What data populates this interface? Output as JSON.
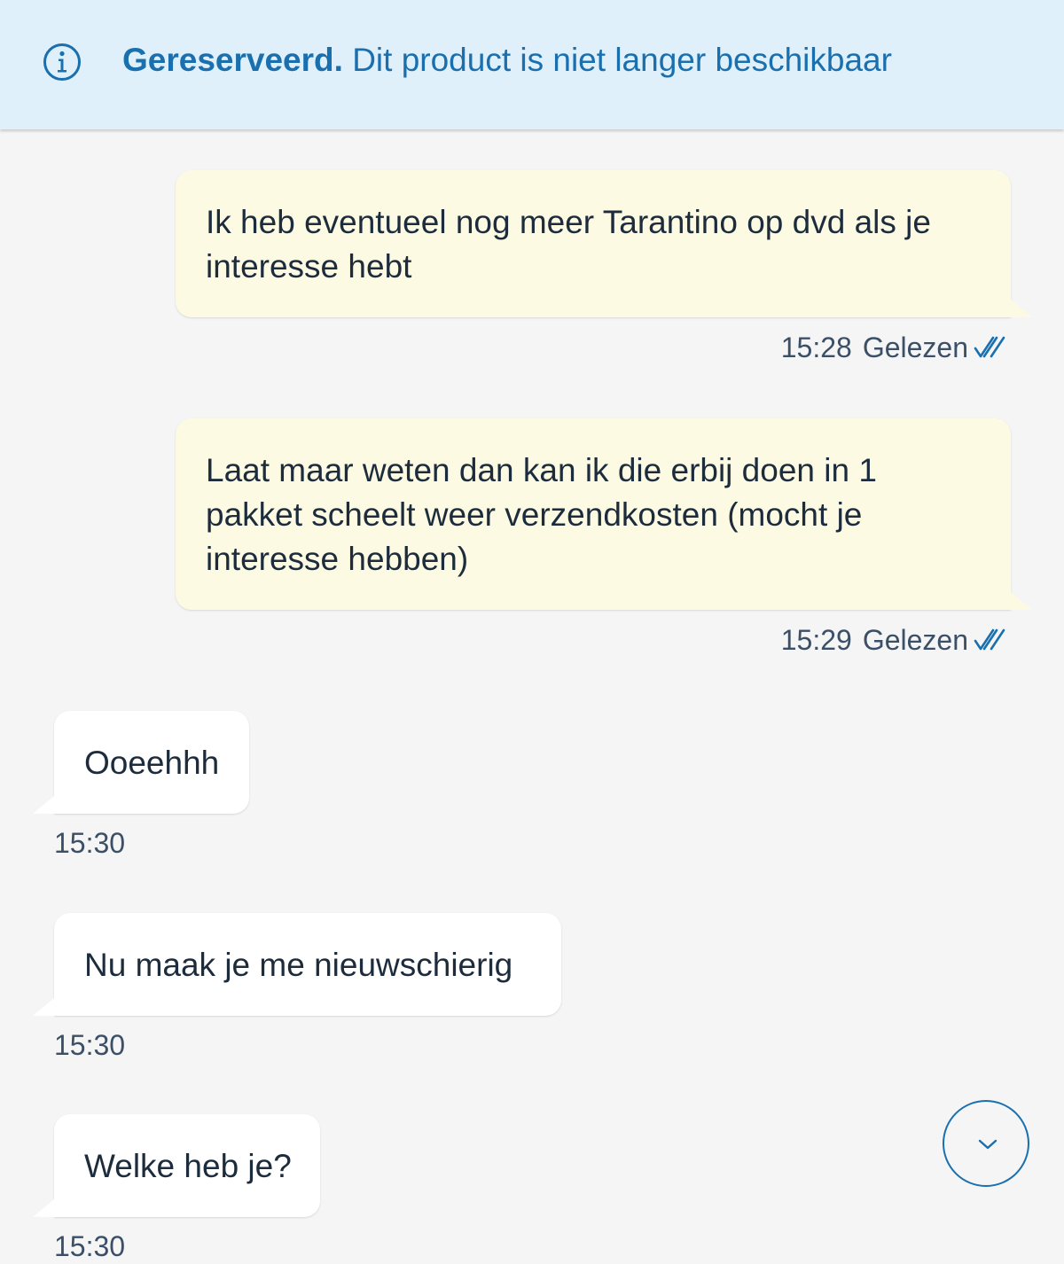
{
  "banner": {
    "icon": "info-icon",
    "status": "Gereserveerd.",
    "message": "Dit product is niet langer beschikbaar"
  },
  "colors": {
    "banner_bg": "#dff0fa",
    "accent": "#1a6fae",
    "outgoing_bubble": "#fdfae3",
    "incoming_bubble": "#ffffff",
    "background": "#f5f5f5"
  },
  "messages": [
    {
      "direction": "out",
      "text": "Ik heb eventueel nog meer Tarantino op dvd als je interesse hebt",
      "time": "15:28",
      "status": "Gelezen"
    },
    {
      "direction": "out",
      "text": "Laat maar weten dan kan ik die erbij doen in 1 pakket scheelt weer verzendkosten (mocht je interesse hebben)",
      "time": "15:29",
      "status": "Gelezen"
    },
    {
      "direction": "in",
      "text": "Ooeehhh",
      "time": "15:30"
    },
    {
      "direction": "in",
      "text": "Nu maak je me nieuwschierig",
      "time": "15:30"
    },
    {
      "direction": "in",
      "text": "Welke heb je?",
      "time": "15:30"
    }
  ],
  "scroll_button": {
    "icon": "chevron-down-icon"
  }
}
